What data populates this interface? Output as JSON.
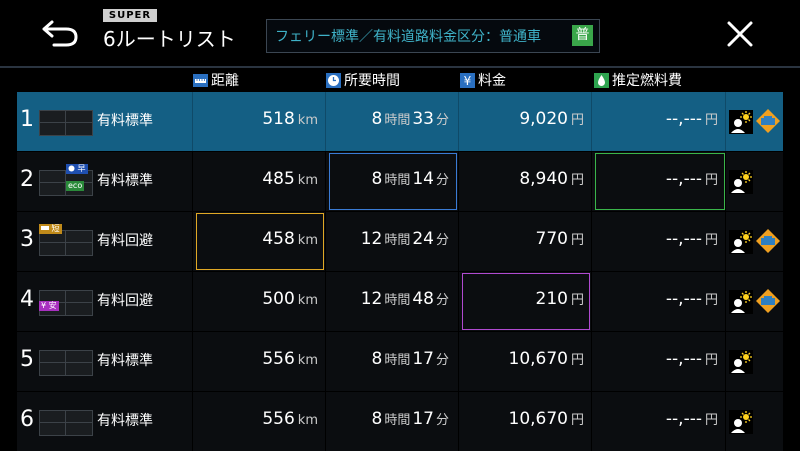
{
  "header": {
    "super_badge": "SUPER",
    "title": "6ルートリスト",
    "conditions": "フェリー標準／有料道路料金区分：普通車",
    "vehicle_badge": "普"
  },
  "columns": {
    "distance": "距離",
    "time": "所要時間",
    "toll": "料金",
    "fuel": "推定燃料費"
  },
  "units": {
    "km": "km",
    "hours": "時間",
    "minutes": "分",
    "yen": "円"
  },
  "tags": {
    "fast": "早",
    "eco": "eco",
    "short": "短",
    "cheap": "¥ 安"
  },
  "routes": [
    {
      "num": "1",
      "type": "有料標準",
      "distance": "518",
      "hours": "8",
      "minutes": "33",
      "toll": "9,020",
      "fuel": "--,---"
    },
    {
      "num": "2",
      "type": "有料標準",
      "distance": "485",
      "hours": "8",
      "minutes": "14",
      "toll": "8,940",
      "fuel": "--,---"
    },
    {
      "num": "3",
      "type": "有料回避",
      "distance": "458",
      "hours": "12",
      "minutes": "24",
      "toll": "770",
      "fuel": "--,---"
    },
    {
      "num": "4",
      "type": "有料回避",
      "distance": "500",
      "hours": "12",
      "minutes": "48",
      "toll": "210",
      "fuel": "--,---"
    },
    {
      "num": "5",
      "type": "有料標準",
      "distance": "556",
      "hours": "8",
      "minutes": "17",
      "toll": "10,670",
      "fuel": "--,---"
    },
    {
      "num": "6",
      "type": "有料標準",
      "distance": "556",
      "hours": "8",
      "minutes": "17",
      "toll": "10,670",
      "fuel": "--,---"
    }
  ],
  "colors": {
    "selected_row": "#145f84",
    "distance_highlight": "#e0a825",
    "time_highlight": "#3a7bd5",
    "toll_highlight": "#b04ad0",
    "fuel_highlight": "#3ab54a",
    "conditions_text": "#3fb2c8"
  },
  "icons": {
    "back": "back-arrow-icon",
    "close": "close-icon",
    "distance": "ruler-icon",
    "time": "clock-icon",
    "toll": "yen-icon",
    "fuel": "fuel-drop-icon",
    "daylight": "sun-person-icon",
    "road": "toll-road-sign-icon"
  }
}
